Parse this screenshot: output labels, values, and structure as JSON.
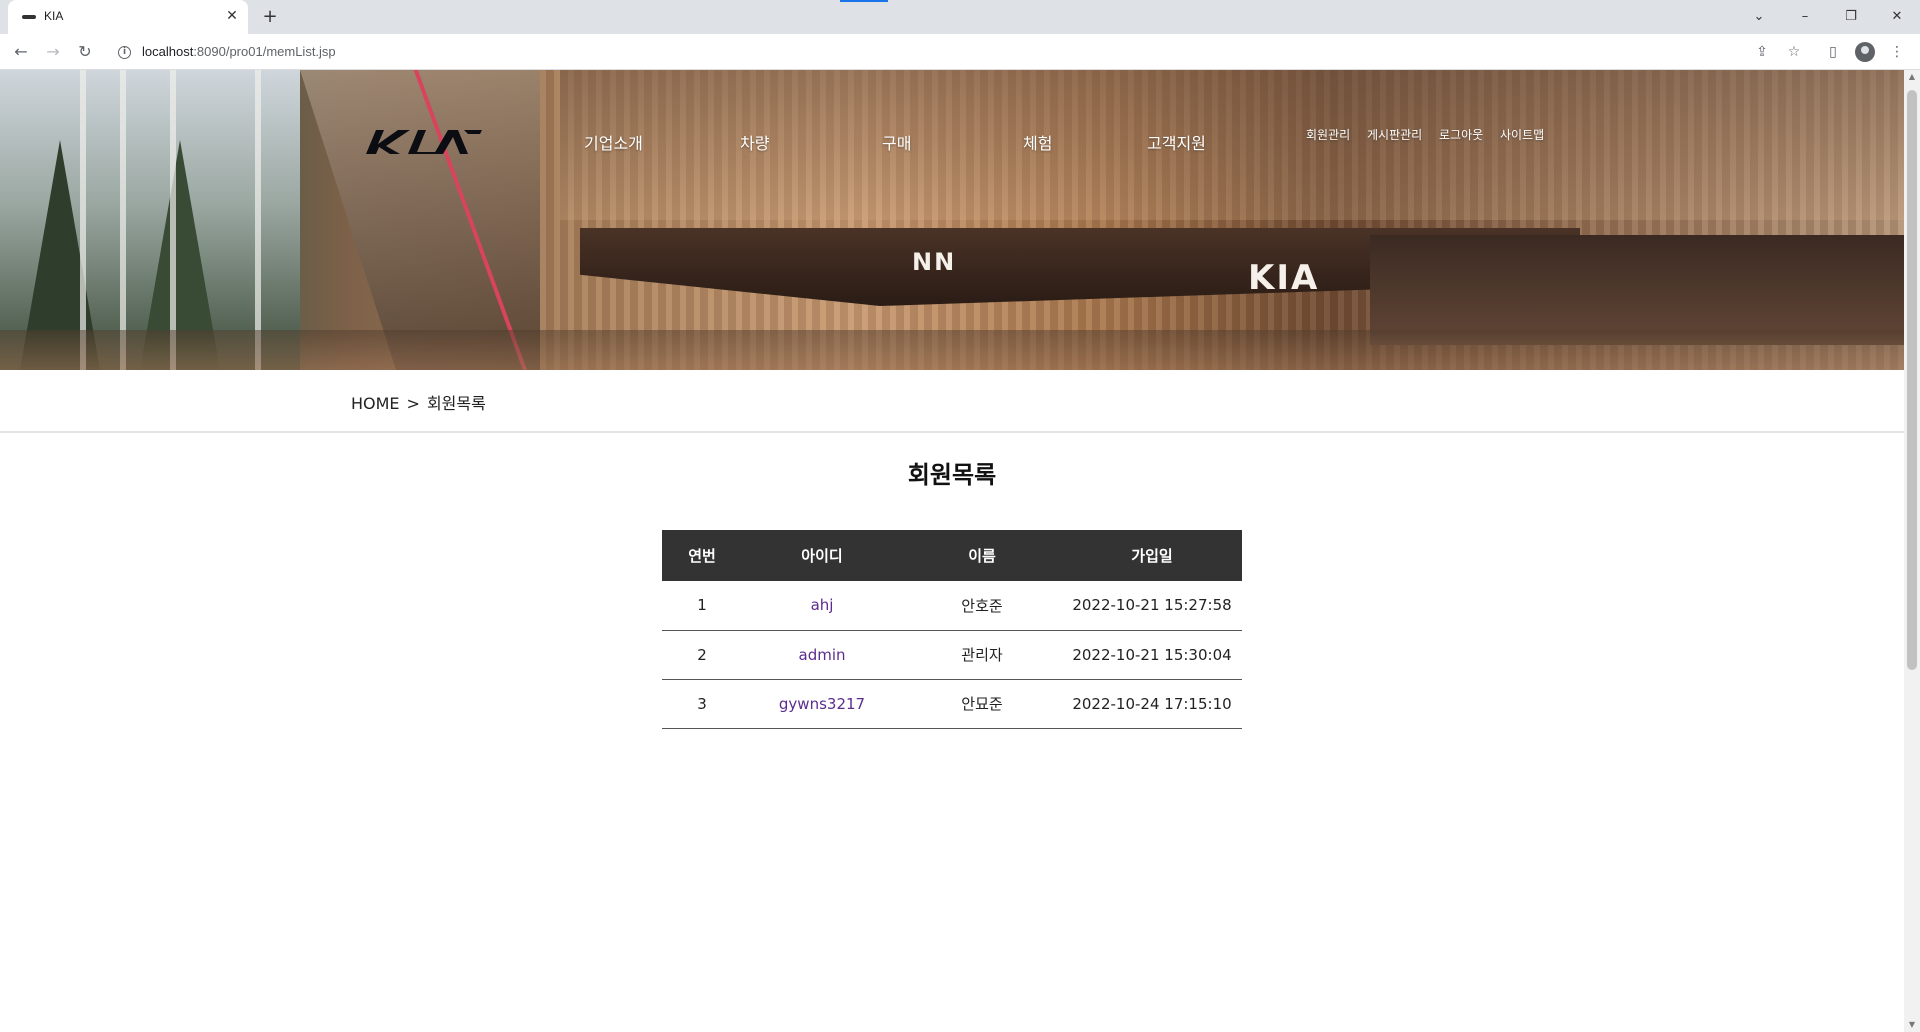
{
  "browser": {
    "tab_title": "KIA",
    "tab_close": "✕",
    "new_tab": "+",
    "url_host": "localhost",
    "url_rest": ":8090/pro01/memList.jsp",
    "icons": [
      "back-icon",
      "forward-icon",
      "reload-icon",
      "site-info-icon",
      "share-icon",
      "bookmark-star-icon",
      "side-panel-icon",
      "profile-icon",
      "menu-icon",
      "tab-search-icon",
      "minimize-icon",
      "restore-icon",
      "close-window-icon"
    ]
  },
  "header": {
    "logo_text": "KIA",
    "gnb": [
      "기업소개",
      "차량",
      "구매",
      "체험",
      "고객지원"
    ],
    "util": [
      "회원관리",
      "게시판관리",
      "로그아웃",
      "사이트맵"
    ]
  },
  "breadcrumb": {
    "home": "HOME",
    "separator": ">",
    "current": "회원목록"
  },
  "page": {
    "title": "회원목록"
  },
  "table": {
    "columns": [
      "연번",
      "아이디",
      "이름",
      "가입일"
    ],
    "rows": [
      {
        "no": "1",
        "id": "ahj",
        "name": "안호준",
        "joined": "2022-10-21 15:27:58"
      },
      {
        "no": "2",
        "id": "admin",
        "name": "관리자",
        "joined": "2022-10-21 15:30:04"
      },
      {
        "no": "3",
        "id": "gywns3217",
        "name": "안묘준",
        "joined": "2022-10-24 17:15:10"
      }
    ]
  },
  "colors": {
    "table_header_bg": "#333333",
    "link_purple": "#5b2d8e",
    "chrome_tabbar": "#dee1e6"
  }
}
